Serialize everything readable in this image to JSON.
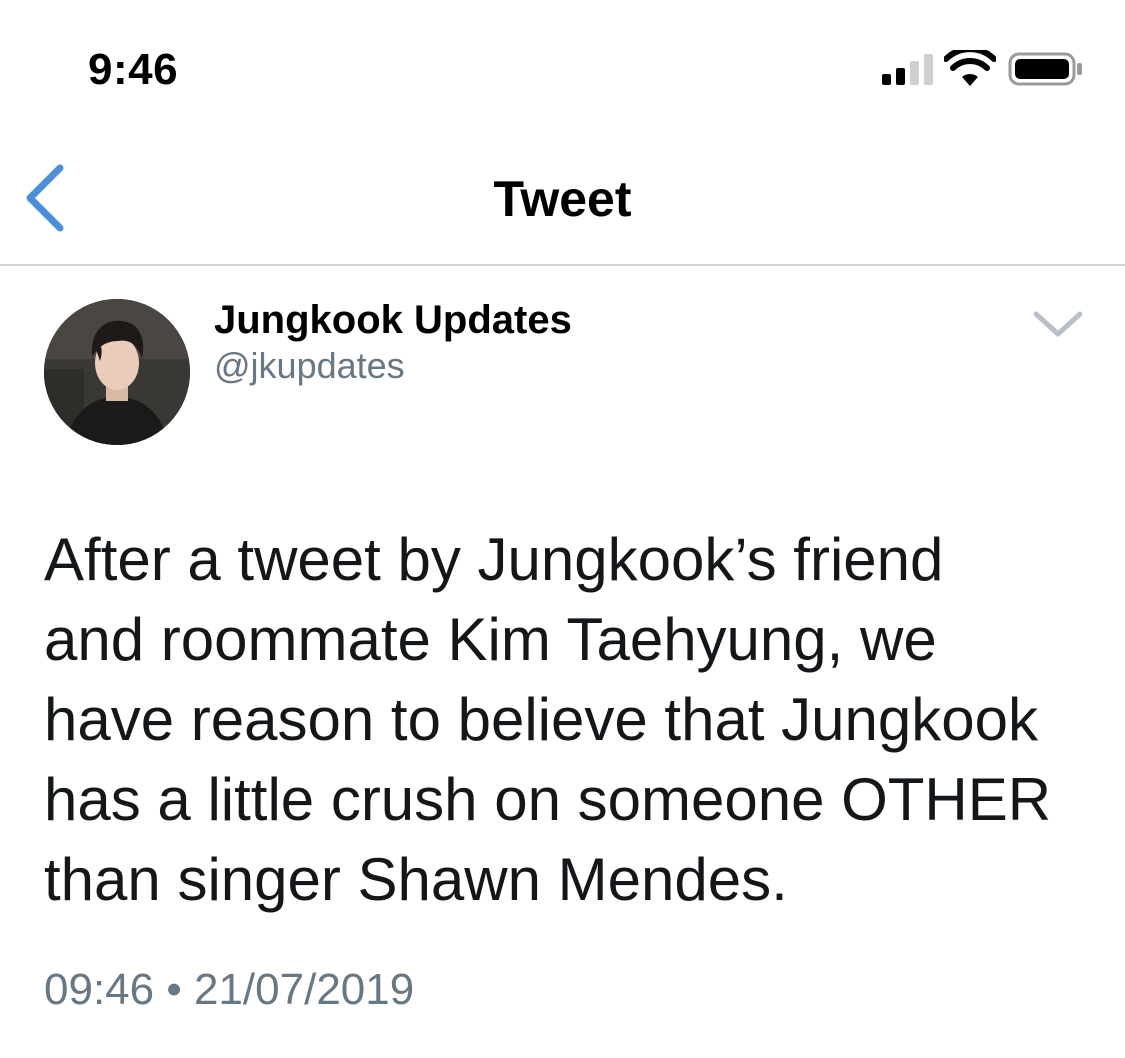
{
  "status_bar": {
    "time": "9:46",
    "signal_icon": "cellular-signal-icon",
    "wifi_icon": "wifi-icon",
    "battery_icon": "battery-icon"
  },
  "nav": {
    "back_icon": "chevron-left-icon",
    "title": "Tweet",
    "accent_color": "#4a90d9"
  },
  "tweet": {
    "author_name": "Jungkook Updates",
    "author_handle": "@jkupdates",
    "menu_icon": "chevron-down-icon",
    "text_lines": [
      "After a tweet by Jungkook’s friend",
      "and roommate Kim Taehyung, we",
      "have reason to believe that Jungkook",
      "has a little crush on someone OTHER",
      "than singer Shawn Mendes."
    ],
    "time": "09:46",
    "separator": "•",
    "date": "21/07/2019",
    "meta_color": "#687784"
  }
}
